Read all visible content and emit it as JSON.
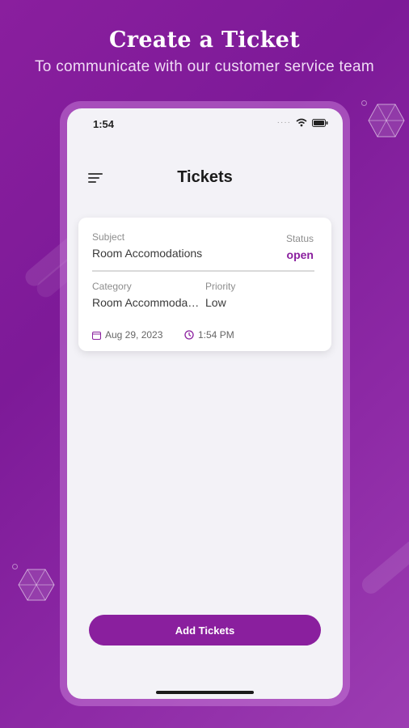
{
  "promo": {
    "headline": "Create a Ticket",
    "subline": "To communicate with our customer service team"
  },
  "status_bar": {
    "time": "1:54",
    "icons": [
      "signal-dots-icon",
      "wifi-icon",
      "battery-icon"
    ]
  },
  "header": {
    "title": "Tickets",
    "menu_icon": "hamburger-menu-icon"
  },
  "ticket": {
    "subject_label": "Subject",
    "subject": "Room Accomodations",
    "status_label": "Status",
    "status": "open",
    "category_label": "Category",
    "category": "Room Accommodations",
    "priority_label": "Priority",
    "priority": "Low",
    "date": "Aug 29, 2023",
    "time": "1:54 PM"
  },
  "actions": {
    "add_label": "Add Tickets"
  },
  "colors": {
    "brand": "#8a1f9e",
    "screen_bg": "#f3f2f7",
    "card_bg": "#ffffff"
  }
}
